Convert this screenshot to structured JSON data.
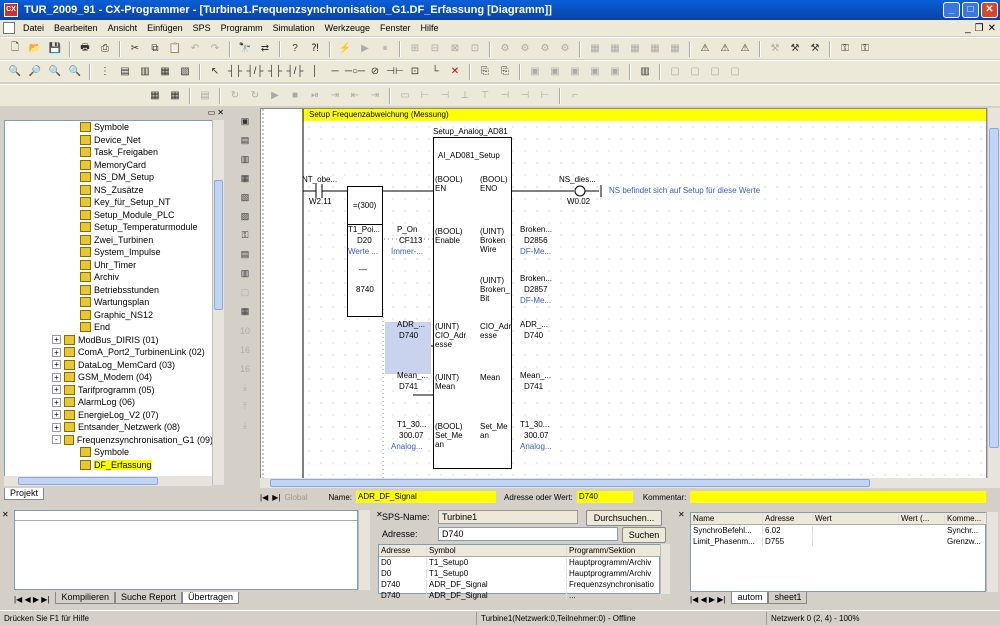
{
  "window": {
    "title": "TUR_2009_91 - CX-Programmer - [Turbine1.Frequenzsynchronisation_G1.DF_Erfassung [Diagramm]]"
  },
  "menu": [
    "Datei",
    "Bearbeiten",
    "Ansicht",
    "Einfügen",
    "SPS",
    "Programm",
    "Simulation",
    "Werkzeuge",
    "Fenster",
    "Hilfe"
  ],
  "tree": {
    "items": [
      {
        "label": "Symbole",
        "indent": 3
      },
      {
        "label": "Device_Net",
        "indent": 3
      },
      {
        "label": "Task_Freigaben",
        "indent": 3
      },
      {
        "label": "MemoryCard",
        "indent": 3
      },
      {
        "label": "NS_DM_Setup",
        "indent": 3
      },
      {
        "label": "NS_Zusätze",
        "indent": 3
      },
      {
        "label": "Key_für_Setup_NT",
        "indent": 3
      },
      {
        "label": "Setup_Module_PLC",
        "indent": 3
      },
      {
        "label": "Setup_Temperaturmodule",
        "indent": 3
      },
      {
        "label": "Zwei_Turbinen",
        "indent": 3
      },
      {
        "label": "System_Impulse",
        "indent": 3
      },
      {
        "label": "Uhr_Timer",
        "indent": 3
      },
      {
        "label": "Archiv",
        "indent": 3
      },
      {
        "label": "Betriebsstunden",
        "indent": 3
      },
      {
        "label": "Wartungsplan",
        "indent": 3
      },
      {
        "label": "Graphic_NS12",
        "indent": 3
      },
      {
        "label": "End",
        "indent": 3
      },
      {
        "label": "ModBus_DIRIS (01)",
        "indent": 1,
        "pm": "+"
      },
      {
        "label": "ComA_Port2_TurbinenLink (02)",
        "indent": 1,
        "pm": "+"
      },
      {
        "label": "DataLog_MemCard (03)",
        "indent": 1,
        "pm": "+"
      },
      {
        "label": "GSM_Modem (04)",
        "indent": 1,
        "pm": "+"
      },
      {
        "label": "Tarifprogramm (05)",
        "indent": 1,
        "pm": "+"
      },
      {
        "label": "AlarmLog (06)",
        "indent": 1,
        "pm": "+"
      },
      {
        "label": "EnergieLog_V2 (07)",
        "indent": 1,
        "pm": "+"
      },
      {
        "label": "Entsander_Netzwerk (08)",
        "indent": 1,
        "pm": "+"
      },
      {
        "label": "Frequenzsynchronisation_G1 (09)",
        "indent": 1,
        "pm": "-"
      },
      {
        "label": "Symbole",
        "indent": 3
      },
      {
        "label": "DF_Erfassung",
        "indent": 3,
        "selected": true
      }
    ],
    "tab_label": "Projekt"
  },
  "diagram": {
    "rung_comment": "Setup Frequenzabweichung (Messung)",
    "contact_in": {
      "name": "NT_obe...",
      "addr": "W2.11"
    },
    "compare": {
      "op": "=(300)",
      "a_name": "T1_Poi...",
      "a_addr": "D20",
      "a_comment": "Werte ...",
      "dash": "—",
      "b_value": "8740"
    },
    "fb_instance": "Setup_Analog_AD81",
    "fb_type": "AI_AD081_Setup",
    "in_pins": [
      {
        "label": "(BOOL)\nEN"
      },
      {
        "label": "(BOOL)\nEnable",
        "var": "P_On",
        "addr": "CF113",
        "comment": "Immer-..."
      },
      {
        "label": "(UINT)\nCIO_Adr\nesse",
        "var": "ADR_...",
        "addr": "D740"
      },
      {
        "label": "(UINT)\nMean",
        "var": "Mean_...",
        "addr": "D741"
      },
      {
        "label": "(BOOL)\nSet_Me\nan",
        "var": "T1_30...",
        "addr": "300.07",
        "comment": "Analog..."
      }
    ],
    "out_pins": [
      {
        "label": "(BOOL)\nENO"
      },
      {
        "label": "(UINT)\nBroken\nWire",
        "var": "Broken...",
        "addr": "D2856",
        "comment": "DF-Me..."
      },
      {
        "label": "(UINT)\nBroken_\nBit",
        "var": "Broken...",
        "addr": "D2857",
        "comment": "DF-Me..."
      },
      {
        "label": "CIO_Adr\nesse",
        "var": "ADR_...",
        "addr": "D740"
      },
      {
        "label": "Mean",
        "var": "Mean_...",
        "addr": "D741"
      },
      {
        "label": "Set_Me\nan",
        "var": "T1_30...",
        "addr": "300.07",
        "comment": "Analog..."
      }
    ],
    "coil_out": {
      "name": "NS_dies...",
      "addr": "W0.02",
      "comment": "NS befindet sich auf Setup für diese Werte"
    }
  },
  "namebar": {
    "global_label": "Global",
    "name_label": "Name:",
    "name_value": "ADR_DF_Signal",
    "addr_label": "Adresse oder Wert:",
    "addr_value": "D740",
    "comment_label": "Kommentar:"
  },
  "output_tabs": [
    "Kompilieren",
    "Suche Report",
    "Übertragen"
  ],
  "symbol_panel": {
    "plc_label": "SPS-Name:",
    "plc_value": "Turbine1",
    "browse": "Durchsuchen...",
    "addr_label": "Adresse:",
    "addr_value": "D740",
    "search": "Suchen",
    "columns": [
      "Adresse",
      "Symbol",
      "Programm/Sektion"
    ],
    "rows": [
      [
        "D0",
        "T1_Setup0",
        "Hauptprogramm/Archiv"
      ],
      [
        "D0",
        "T1_Setup0",
        "Hauptprogramm/Archiv"
      ],
      [
        "D740",
        "ADR_DF_Signal",
        "Frequenzsynchronisatio"
      ],
      [
        "D740",
        "ADR_DF_Signal",
        "..."
      ]
    ]
  },
  "watch_panel": {
    "columns": [
      "Name",
      "Adresse",
      "Wert",
      "Wert (...",
      "Komme..."
    ],
    "rows": [
      [
        "SynchroBefehl...",
        "6.02",
        "",
        "",
        "Synchr..."
      ],
      [
        "Limit_Phasenm...",
        "D755",
        "",
        "",
        "Grenzw..."
      ]
    ],
    "tabs": [
      "autom",
      "sheet1"
    ]
  },
  "status": {
    "help": "Drücken Sie F1 für Hilfe",
    "plc": "Turbine1(Netzwerk:0,Teilnehmer:0) - Offline",
    "pos": "Netzwerk 0 (2, 4) - 100%"
  }
}
